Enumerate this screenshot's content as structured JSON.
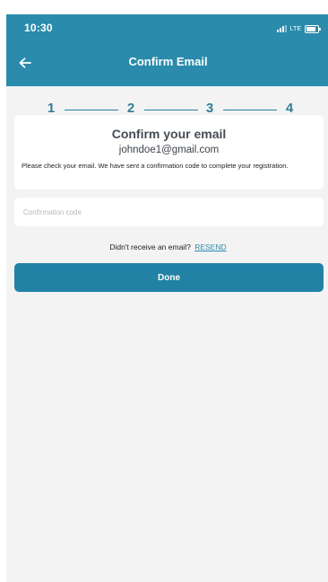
{
  "status_bar": {
    "time": "10:30",
    "network": "LTE",
    "icons": [
      "signal-icon",
      "battery-icon"
    ]
  },
  "header": {
    "title": "Confirm Email",
    "back_icon": "arrow-left-icon"
  },
  "stepper": {
    "steps": [
      "1",
      "2",
      "3",
      "4"
    ]
  },
  "card": {
    "title": "Confirm your email",
    "email": "johndoe1@gmail.com",
    "message": "Please check your email. We have sent a confirmation code to complete your registration."
  },
  "code_input": {
    "placeholder": "Confirmation code",
    "value": ""
  },
  "resend": {
    "prompt": "Didn't receive an email?",
    "link_label": "RESEND"
  },
  "done_button": {
    "label": "Done"
  },
  "colors": {
    "brand": "#2a8bac",
    "button": "#2182a5",
    "background": "#f3f3f4",
    "step_text": "#2f7e98"
  }
}
